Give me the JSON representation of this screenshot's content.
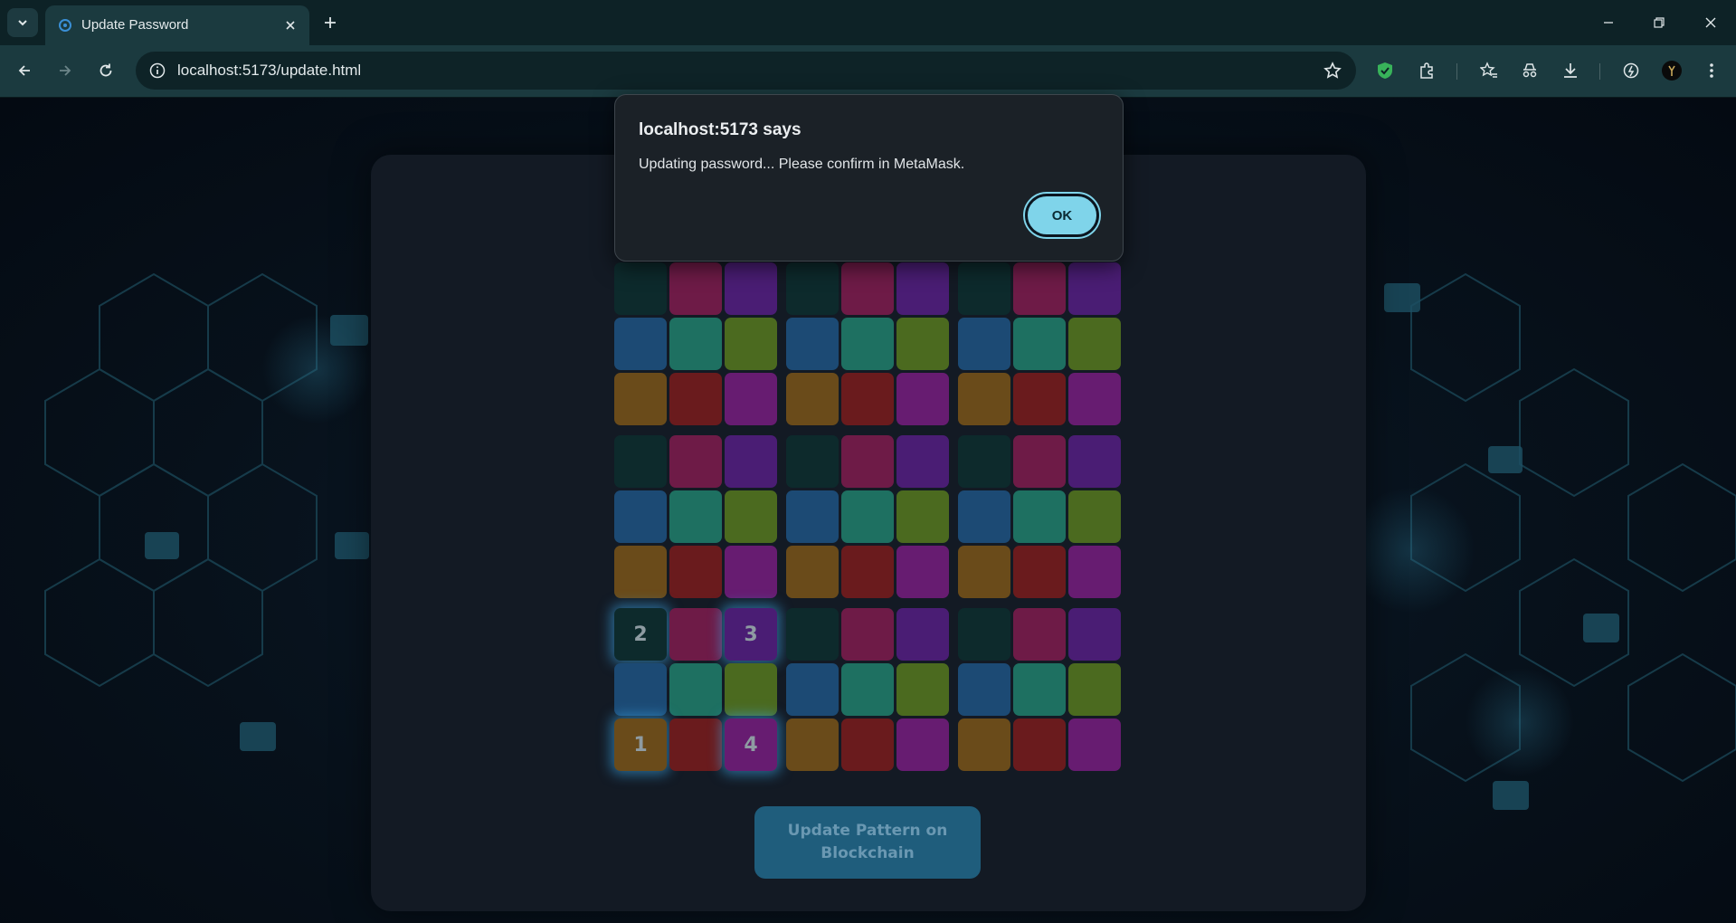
{
  "browser": {
    "tab_title": "Update Password",
    "url": "localhost:5173/update.html"
  },
  "dialog": {
    "title": "localhost:5173 says",
    "message": "Updating password... Please confirm in MetaMask.",
    "ok_label": "OK"
  },
  "pattern_grid": {
    "palette": [
      "#0d2a2c",
      "#6e1b47",
      "#4a1d74",
      "#1c4a74",
      "#1e7061",
      "#4b6a1f",
      "#6a4b1a",
      "#6a1b1d",
      "#671c71"
    ],
    "selected": [
      {
        "block": 6,
        "cell": 6,
        "label": "1"
      },
      {
        "block": 6,
        "cell": 0,
        "label": "2"
      },
      {
        "block": 6,
        "cell": 2,
        "label": "3"
      },
      {
        "block": 6,
        "cell": 8,
        "label": "4"
      }
    ]
  },
  "update_button": {
    "label": "Update Pattern on Blockchain"
  }
}
